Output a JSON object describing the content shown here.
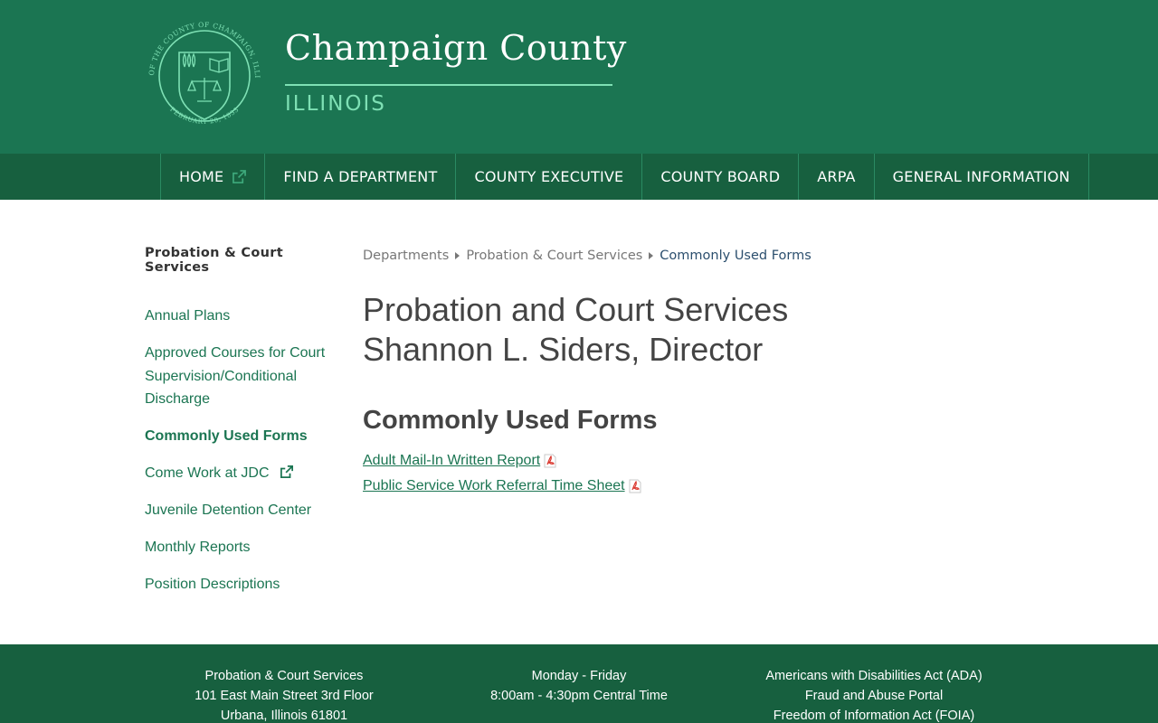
{
  "header": {
    "title": "Champaign County",
    "subtitle": "ILLINOIS",
    "seal_outer_text": "SEAL OF THE COUNTY OF CHAMPAIGN, ILLINOIS",
    "seal_date_text": "FEBRUARY 20, 1833"
  },
  "nav": {
    "items": [
      {
        "label": "HOME",
        "external": true
      },
      {
        "label": "FIND A DEPARTMENT"
      },
      {
        "label": "COUNTY EXECUTIVE"
      },
      {
        "label": "COUNTY BOARD"
      },
      {
        "label": "ARPA"
      },
      {
        "label": "GENERAL INFORMATION"
      }
    ]
  },
  "sidebar": {
    "heading": "Probation & Court Services",
    "items": [
      {
        "label": "Annual Plans"
      },
      {
        "label": "Approved Courses for Court Supervision/Conditional Discharge"
      },
      {
        "label": "Commonly Used Forms",
        "active": true
      },
      {
        "label": "Come Work at JDC",
        "external": true
      },
      {
        "label": "Juvenile Detention Center"
      },
      {
        "label": "Monthly Reports"
      },
      {
        "label": "Position Descriptions"
      }
    ]
  },
  "breadcrumb": [
    "Departments",
    "Probation & Court Services",
    "Commonly Used Forms"
  ],
  "main": {
    "title_line1": "Probation and Court Services",
    "title_line2": "Shannon L. Siders, Director",
    "section_title": "Commonly Used Forms",
    "forms": [
      {
        "label": "Adult Mail-In Written Report",
        "icon": "pdf-icon"
      },
      {
        "label": "Public Service Work Referral Time Sheet",
        "icon": "pdf-icon"
      }
    ]
  },
  "footer": {
    "address": [
      "Probation & Court Services",
      "101 East Main Street 3rd Floor",
      "Urbana, Illinois 61801"
    ],
    "hours": [
      "Monday - Friday",
      "8:00am - 4:30pm Central Time"
    ],
    "links": [
      "Americans with Disabilities Act (ADA)",
      "Fraud and Abuse Portal",
      "Freedom of Information Act (FOIA)"
    ]
  },
  "colors": {
    "header_green": "#1b7552",
    "nav_green": "#17603f",
    "accent_mint": "#7ee0b4",
    "link_green": "#1b7552",
    "breadcrumb_current": "#2c4f6e"
  }
}
